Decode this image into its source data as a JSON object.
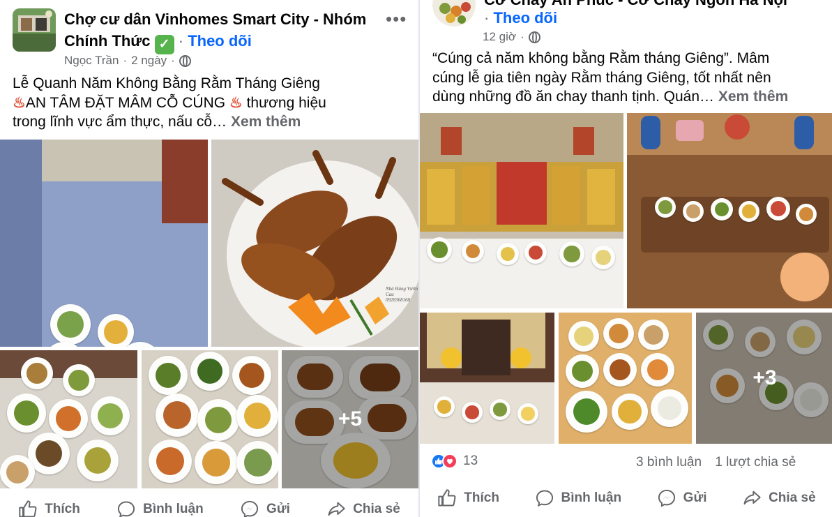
{
  "left_post": {
    "group_name_line1": "Chợ cư dân Vinhomes Smart City - Nhóm",
    "group_name_line2": "Chính Thức",
    "verified_glyph": "✓",
    "follow_label": "Theo dõi",
    "separator": "·",
    "author": "Ngọc Trần",
    "time": "2 ngày",
    "more_label": "•••",
    "text_line1": "Lễ Quanh Năm Không Bằng Rằm Tháng Giêng",
    "hot_icon": "♨",
    "text_line2": "AN TÂM ĐẶT MÂM CỖ CÚNG",
    "text_line2b": "thương hiệu",
    "text_line3": "trong lĩnh vực ẩm thực, nấu cỗ…",
    "see_more": "Xem thêm",
    "watermark_1": "Nhà Hàng Vườn Cau",
    "watermark_2": "0928368168",
    "extra_photos": "+5",
    "actions": {
      "like": "Thích",
      "comment": "Bình luận",
      "send": "Gửi",
      "share": "Chia sẻ"
    }
  },
  "right_post": {
    "page_name_partial": "Cơ Chay An Phúc - Cơ Chay Ngon Hà Nội",
    "separator": "·",
    "follow_label": "Theo dõi",
    "time": "12 giờ",
    "text_line1": "“Cúng cả năm không bằng Rằm tháng Giêng”. Mâm",
    "text_line2": "cúng lễ gia tiên ngày Rằm tháng Giêng, tốt nhất nên",
    "text_line3": "dùng những đồ ăn chay thanh tịnh. Quán…",
    "see_more": "Xem thêm",
    "extra_photos": "+3",
    "reaction_count": "13",
    "comments": "3 bình luận",
    "shares": "1 lượt chia sẻ",
    "actions": {
      "like": "Thích",
      "comment": "Bình luận",
      "send": "Gửi",
      "share": "Chia sẻ"
    }
  },
  "colors": {
    "follow": "#0866ff",
    "secondary_text": "#65676b",
    "like_blue": "#1877f2",
    "love_red": "#f33e58",
    "verified_green": "#57b34b"
  },
  "icons": [
    "globe-icon",
    "verified-icon",
    "like-icon",
    "comment-icon",
    "send-icon",
    "share-icon",
    "more-icon",
    "hot-springs-icon"
  ]
}
